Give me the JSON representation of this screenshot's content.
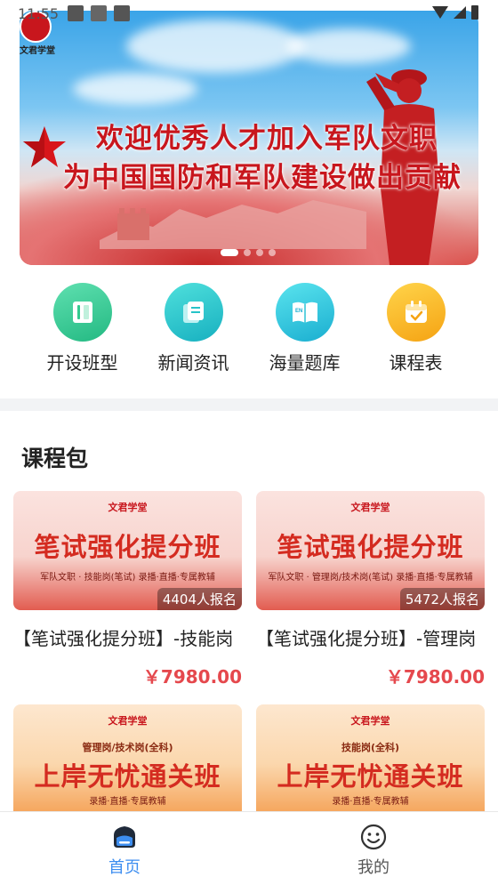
{
  "status_bar": {
    "time": "11:55"
  },
  "banner": {
    "logo_text": "文君学堂",
    "line1": "欢迎优秀人才加入军队文职",
    "line2": "为中国国防和军队建设做出贡献",
    "slides": 4,
    "active_slide": 1
  },
  "quick_nav": [
    {
      "label": "开设班型",
      "icon": "book-icon",
      "color": "#34c98f"
    },
    {
      "label": "新闻资讯",
      "icon": "news-icon",
      "color": "#26c3c8"
    },
    {
      "label": "海量题库",
      "icon": "question-bank-icon",
      "color": "#2cc3d6"
    },
    {
      "label": "课程表",
      "icon": "calendar-icon",
      "color": "#f7b21b"
    }
  ],
  "section": {
    "title": "课程包"
  },
  "courses": [
    {
      "logo": "文君学堂",
      "img_title": "笔试强化提分班",
      "img_tag": "军队文职 · 技能岗(笔试)  录播·直播·专属教辅",
      "enrolled": "4404人报名",
      "name": "【笔试强化提分班】-技能岗",
      "price": "￥7980.00"
    },
    {
      "logo": "文君学堂",
      "img_title": "笔试强化提分班",
      "img_tag": "军队文职 · 管理岗/技术岗(笔试)  录播·直播·专属教辅",
      "enrolled": "5472人报名",
      "name": "【笔试强化提分班】-管理岗",
      "price": "￥7980.00"
    },
    {
      "logo": "文君学堂",
      "img_tag_top": "管理岗/技术岗(全科)",
      "img_title": "上岸无忧通关班",
      "img_tag": "录播·直播·专属教辅"
    },
    {
      "logo": "文君学堂",
      "img_tag_top": "技能岗(全科)",
      "img_title": "上岸无忧通关班",
      "img_tag": "录播·直播·专属教辅"
    }
  ],
  "tabbar": [
    {
      "label": "首页",
      "active": true
    },
    {
      "label": "我的",
      "active": false
    }
  ],
  "colors": {
    "accent": "#3d8ef0",
    "price": "#e5484d",
    "inactive_tab": "#555555"
  }
}
